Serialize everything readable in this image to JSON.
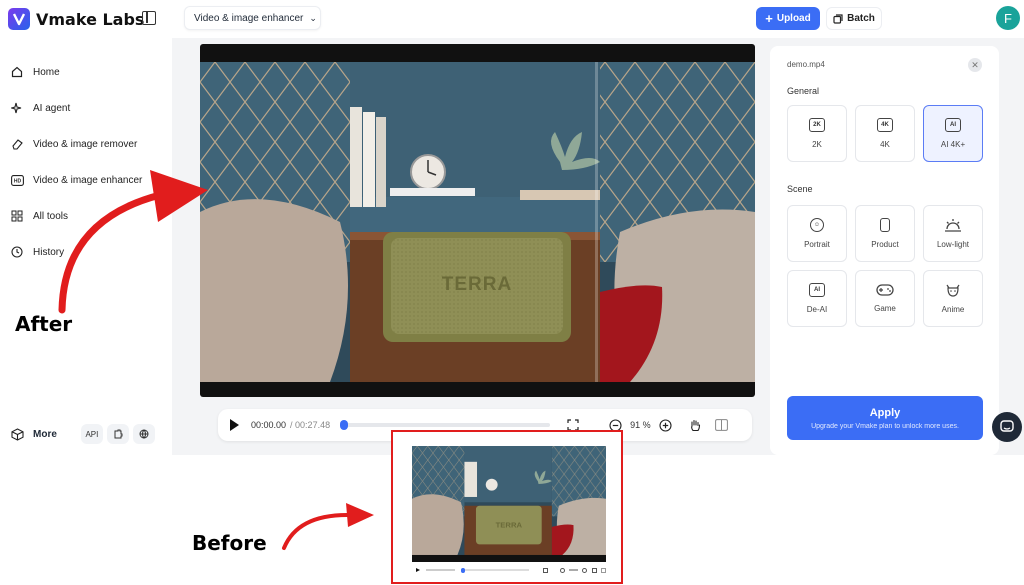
{
  "app": {
    "title": "Vmake Labs"
  },
  "sidebar": {
    "items": [
      {
        "label": "Home",
        "icon": "home-icon"
      },
      {
        "label": "AI agent",
        "icon": "sparkle-icon"
      },
      {
        "label": "Video & image remover",
        "icon": "eraser-icon"
      },
      {
        "label": "Video & image enhancer",
        "icon": "hd-icon"
      },
      {
        "label": "All tools",
        "icon": "grid-icon"
      },
      {
        "label": "History",
        "icon": "clock-icon"
      }
    ],
    "more_label": "More",
    "api_label": "API"
  },
  "header": {
    "tool_select": "Video & image enhancer",
    "upload_label": "Upload",
    "batch_label": "Batch",
    "avatar_letter": "F"
  },
  "player": {
    "current_time": "00:00.00",
    "total_time": "/ 00:27.48",
    "zoom": "91 %",
    "progress": 0.0,
    "product_text": "TERRA"
  },
  "panel": {
    "filename": "demo.mp4",
    "general_title": "General",
    "general_options": [
      {
        "label": "2K",
        "badge": "2K",
        "selected": false
      },
      {
        "label": "4K",
        "badge": "4K",
        "selected": false
      },
      {
        "label": "AI 4K+",
        "badge": "AI",
        "selected": true
      }
    ],
    "scene_title": "Scene",
    "scene_options": [
      {
        "label": "Portrait"
      },
      {
        "label": "Product"
      },
      {
        "label": "Low-light"
      },
      {
        "label": "De-AI"
      },
      {
        "label": "Game"
      },
      {
        "label": "Anime"
      }
    ],
    "apply_label": "Apply",
    "apply_sub": "Upgrade your Vmake plan to unlock more uses."
  },
  "annotations": {
    "after": "After",
    "before": "Before"
  },
  "colors": {
    "accent": "#3b6df5",
    "arrow": "#e11d1d",
    "avatar": "#1aa39a"
  }
}
